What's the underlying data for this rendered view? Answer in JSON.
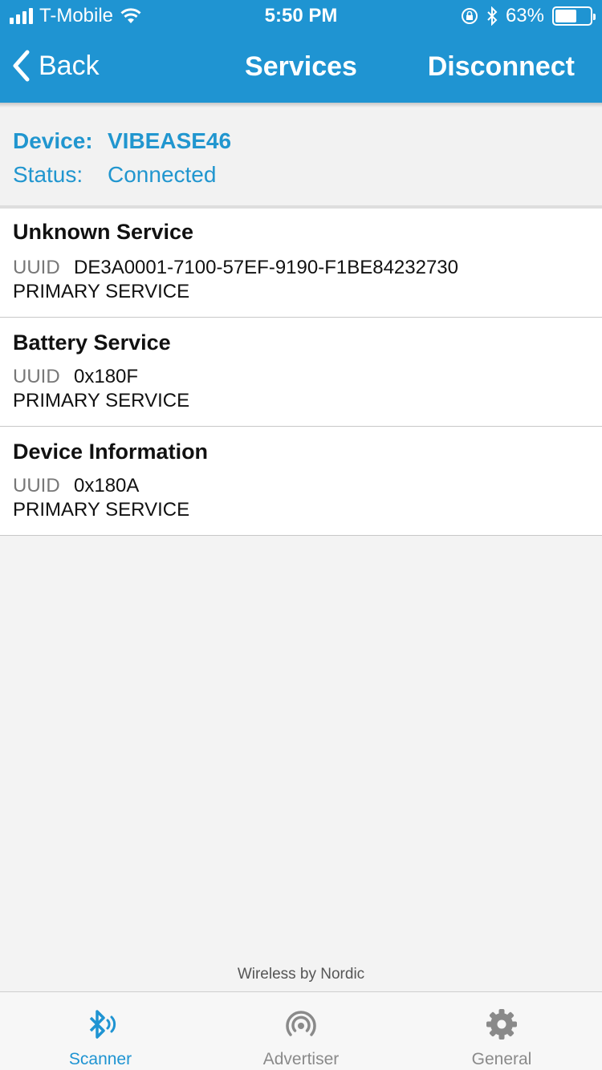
{
  "status_bar": {
    "carrier": "T-Mobile",
    "time": "5:50 PM",
    "battery_percent": "63%",
    "battery_level": 0.63,
    "icons": [
      "signal-icon",
      "wifi-icon",
      "orientation-lock-icon",
      "bluetooth-icon",
      "battery-icon"
    ]
  },
  "nav": {
    "back_label": "Back",
    "title": "Services",
    "action_label": "Disconnect"
  },
  "device": {
    "device_label": "Device:",
    "device_name": "VIBEASE46",
    "status_label": "Status:",
    "status_value": "Connected"
  },
  "services": [
    {
      "name": "Unknown Service",
      "uuid_label": "UUID",
      "uuid": "DE3A0001-7100-57EF-9190-F1BE84232730",
      "type": "PRIMARY SERVICE"
    },
    {
      "name": "Battery Service",
      "uuid_label": "UUID",
      "uuid": "0x180F",
      "type": "PRIMARY SERVICE"
    },
    {
      "name": "Device Information",
      "uuid_label": "UUID",
      "uuid": "0x180A",
      "type": "PRIMARY SERVICE"
    }
  ],
  "footer": {
    "text": "Wireless by Nordic"
  },
  "tabs": [
    {
      "label": "Scanner",
      "icon": "bluetooth-scanner-icon",
      "active": true
    },
    {
      "label": "Advertiser",
      "icon": "advertiser-icon",
      "active": false
    },
    {
      "label": "General",
      "icon": "gear-icon",
      "active": false
    }
  ],
  "colors": {
    "accent": "#1f94d2",
    "header_text": "#2196cf",
    "tab_active": "#1f94d2",
    "tab_inactive": "#8a8a8a",
    "background": "#f3f3f3"
  }
}
